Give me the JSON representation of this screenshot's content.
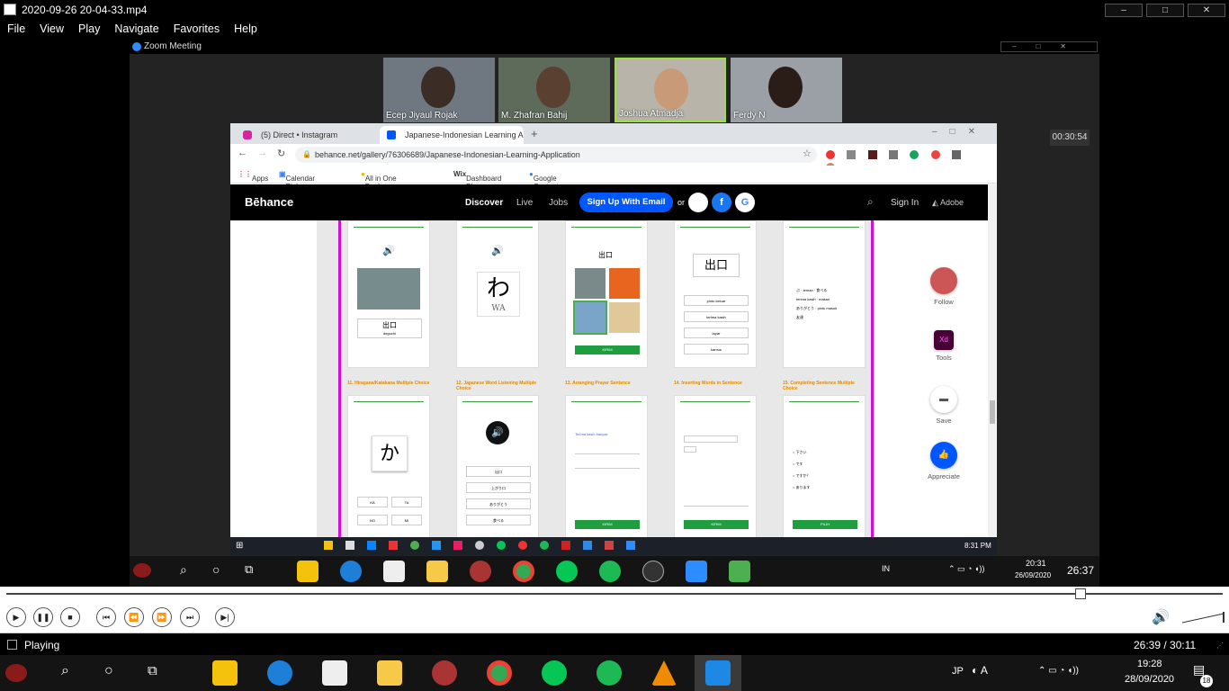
{
  "player": {
    "file_title": "2020-09-26 20-04-33.mp4",
    "menu": [
      "File",
      "View",
      "Play",
      "Navigate",
      "Favorites",
      "Help"
    ],
    "status": "Playing",
    "time": "26:39 / 30:11",
    "progress_fraction": 0.883
  },
  "zoom": {
    "window_title": "Zoom Meeting",
    "elapsed": "00:30:54",
    "participants": [
      {
        "name": "Ecep Jiyaul Rojak"
      },
      {
        "name": "M. Zhafran Bahij"
      },
      {
        "name": "Joshua Atmadja"
      },
      {
        "name": "Ferdy N"
      }
    ]
  },
  "browser": {
    "tabs": [
      {
        "label": "(5) Direct • Instagram"
      },
      {
        "label": "Japanese-Indonesian Learning A"
      }
    ],
    "url": "behance.net/gallery/76306689/Japanese-Indonesian-Learning-Application",
    "bookmarks": [
      "Apps",
      "Calendar Pinhome",
      "All in One Bookmar...",
      "Dashboard Blog",
      "Google Contacts"
    ]
  },
  "behance": {
    "logo": "Bēhance",
    "nav": [
      "Discover",
      "Live",
      "Jobs"
    ],
    "signup": "Sign Up With Email",
    "or": "or",
    "signin": "Sign In",
    "adobe": "Adobe",
    "social": [
      "",
      "f",
      "G"
    ],
    "sidebar": [
      {
        "label": "Follow",
        "icon": "avatar-icon"
      },
      {
        "label": "Tools",
        "icon": "xd-icon",
        "glyph": "Xd"
      },
      {
        "label": "Save",
        "icon": "folder-icon"
      },
      {
        "label": "Appreciate",
        "icon": "thumbs-up-icon"
      }
    ],
    "cards_top": [
      {
        "kanji": "出口",
        "sub": "deguchi"
      },
      {
        "kanji": "わ",
        "sub": "WA"
      },
      {
        "kanji": "出口",
        "button": "KIRIM"
      },
      {
        "kanji": "出口",
        "options": [
          "pintu keluar",
          "terima kasih",
          "lapar",
          "kamus"
        ]
      },
      {
        "words": [
          "ぶ",
          "teman",
          "食べる",
          "terima kasih",
          "makan",
          "ありがとう",
          "pintu masuk",
          "友達"
        ]
      }
    ],
    "cards_bottom": [
      {
        "label": "11. Hiragana/Katakana Multiple Choice",
        "kana": "か",
        "options": [
          "KA",
          "TA",
          "NO",
          "MI"
        ]
      },
      {
        "label": "12. Japanese Word Listening Multiple Choice",
        "options": [
          "出口",
          "上がり口",
          "ありがとう",
          "食べる"
        ]
      },
      {
        "label": "13. Arranging Prayer Sentence",
        "text": "Terima kasih banyak",
        "button": "KIRIM"
      },
      {
        "label": "14. Inserting Words in Sentence",
        "button": "KIRIM"
      },
      {
        "label": "15. Completing Sentence Multiple Choice",
        "choices": [
          "下さい",
          "です",
          "ですか？",
          "あります"
        ],
        "button": "PILIH"
      }
    ]
  },
  "remote": {
    "inner_clock": "8:31 PM",
    "clock": "20:31",
    "date": "26/09/2020",
    "lang": "IN",
    "overlay_time": "26:37"
  },
  "host_taskbar": {
    "lang": "JP",
    "clock": "19:28",
    "date": "28/09/2020",
    "notifications": "18"
  },
  "colors": {
    "behance_blue": "#0057ff",
    "guide_line": "#d10fd8",
    "kirim_green": "#1e9e3e",
    "label_orange": "#e08a00"
  }
}
